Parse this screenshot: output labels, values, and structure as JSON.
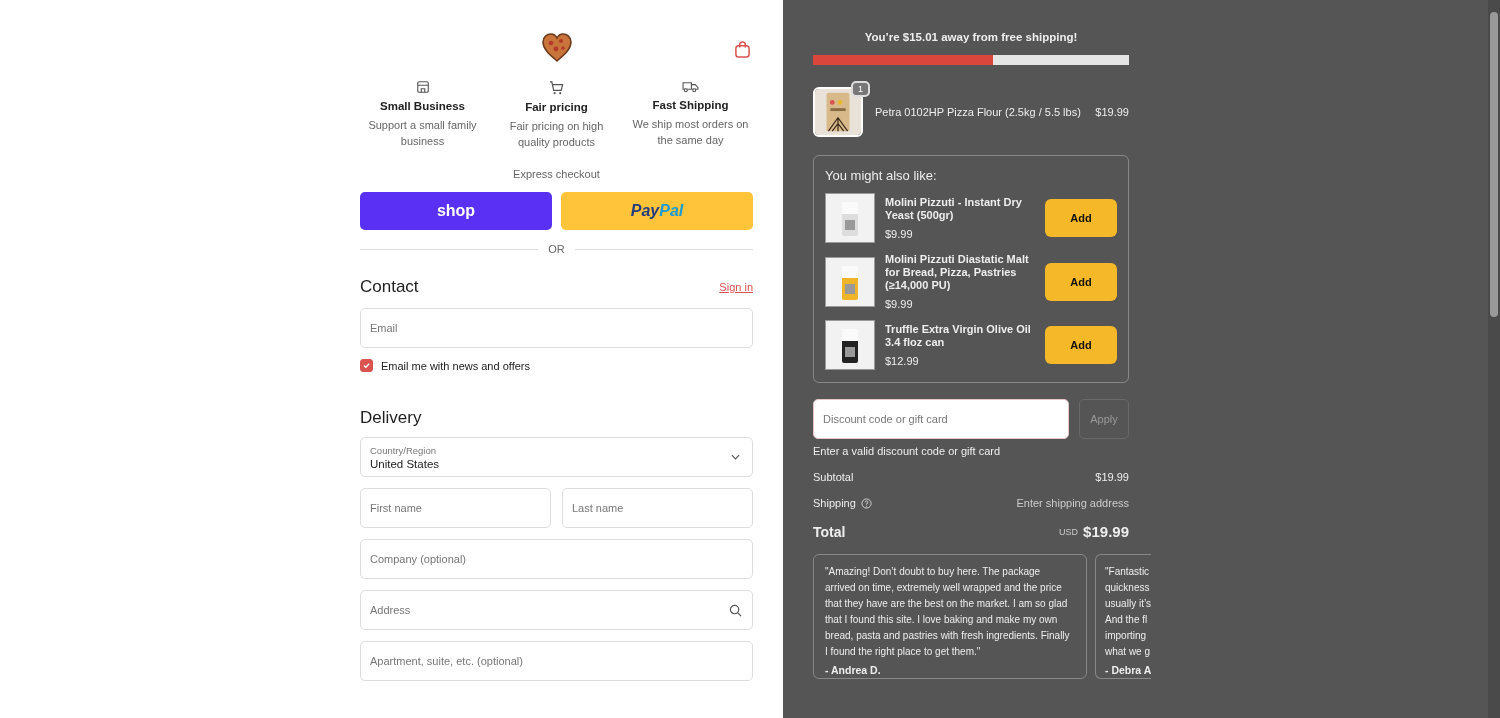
{
  "features": [
    {
      "kind": "store",
      "title": "Small Business",
      "text": "Support a small family business"
    },
    {
      "kind": "cart",
      "title": "Fair pricing",
      "text": "Fair pricing on high quality products"
    },
    {
      "kind": "truck",
      "title": "Fast Shipping",
      "text": "We ship most orders on the same day"
    }
  ],
  "express": {
    "label": "Express checkout",
    "shop": "shop",
    "paypal_dark": "Pay",
    "paypal_light": "Pal",
    "divider": "OR"
  },
  "contact": {
    "heading": "Contact",
    "sign_in": "Sign in",
    "email_placeholder": "Email",
    "newsletter": {
      "label": "Email me with news and offers",
      "checked": true
    }
  },
  "delivery": {
    "heading": "Delivery",
    "country": {
      "label": "Country/Region",
      "value": "United States"
    },
    "rows": [
      [
        {
          "placeholder": "First name",
          "kind": "text"
        },
        {
          "placeholder": "Last name",
          "kind": "text"
        }
      ],
      [
        {
          "placeholder": "Company (optional)",
          "kind": "text"
        }
      ],
      [
        {
          "placeholder": "Address",
          "kind": "search"
        }
      ],
      [
        {
          "placeholder": "Apartment, suite, etc. (optional)",
          "kind": "text"
        }
      ]
    ]
  },
  "shipping_banner": {
    "text": "You’re $15.01 away from free shipping!",
    "level": 0.57
  },
  "cart": [
    {
      "name": "Petra 0102HP Pizza Flour (2.5kg / 5.5 lbs)",
      "quantity": "1",
      "price": "$19.99"
    }
  ],
  "upsell": {
    "title": "You might also like:",
    "items": [
      {
        "name": "Molini Pizzuti - Instant Dry Yeast (500gr)",
        "price": "$9.99",
        "button": "Add"
      },
      {
        "name": "Molini Pizzuti Diastatic Malt for Bread, Pizza, Pastries (≥14,000 PU)",
        "price": "$9.99",
        "button": "Add"
      },
      {
        "name": "Truffle Extra Virgin Olive Oil 3.4 floz can",
        "price": "$12.99",
        "button": "Add"
      }
    ]
  },
  "discount": {
    "placeholder": "Discount code or gift card",
    "button": "Apply",
    "error": "Enter a valid discount code or gift card"
  },
  "summary": {
    "subtotal_label": "Subtotal",
    "subtotal": "$19.99",
    "shipping_label": "Shipping",
    "shipping": "Enter shipping address",
    "total_label": "Total",
    "currency": "USD",
    "total": "$19.99"
  },
  "reviews": [
    {
      "lines": [
        "\"Amazing! Don’t doubt to buy here. The package",
        "arrived on time, extremely well wrapped and the price",
        "that they have are the best on the market. I am so glad",
        "that I found this site. I love baking and make my own",
        "bread, pasta and pastries with fresh ingredients. Finally",
        "I found the right place to get them.\""
      ],
      "author": "- Andrea D."
    },
    {
      "lines": [
        "\"Fantastic",
        "quickness",
        "usually it’s",
        "And the fl",
        "importing",
        "what we g"
      ],
      "author": "- Debra A"
    }
  ]
}
